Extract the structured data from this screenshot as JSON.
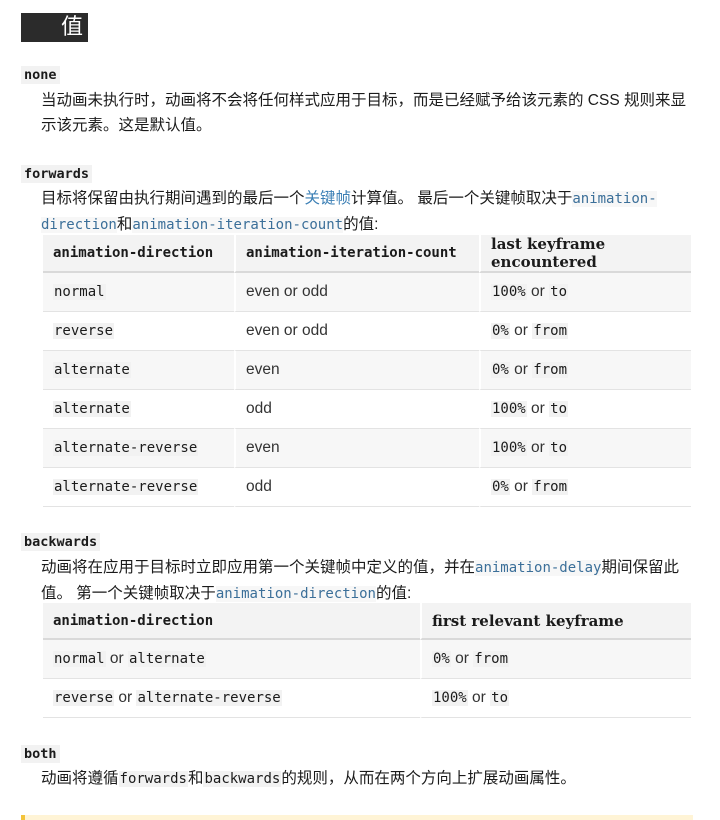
{
  "heading": "值",
  "none": {
    "term": "none",
    "desc": "当动画未执行时，动画将不会将任何样式应用于目标，而是已经赋予给该元素的 CSS 规则来显示该元素。这是默认值。"
  },
  "forwards": {
    "term": "forwards",
    "desc_a": "目标将保留由执行期间遇到的最后一个",
    "desc_link": "关键帧",
    "desc_b": "计算值。 最后一个关键帧取决于",
    "desc_code1": "animation-direction",
    "desc_c": "和",
    "desc_code2": "animation-iteration-count",
    "desc_d": "的值:",
    "table": {
      "headers": [
        "animation-direction",
        "animation-iteration-count",
        "last keyframe encountered"
      ],
      "rows": [
        {
          "dir": "normal",
          "count": "even or odd",
          "kf1": "100%",
          "or": "or",
          "kf2": "to"
        },
        {
          "dir": "reverse",
          "count": "even or odd",
          "kf1": "0%",
          "or": "or",
          "kf2": "from"
        },
        {
          "dir": "alternate",
          "count": "even",
          "kf1": "0%",
          "or": "or",
          "kf2": "from"
        },
        {
          "dir": "alternate",
          "count": "odd",
          "kf1": "100%",
          "or": "or",
          "kf2": "to"
        },
        {
          "dir": "alternate-reverse",
          "count": "even",
          "kf1": "100%",
          "or": "or",
          "kf2": "to"
        },
        {
          "dir": "alternate-reverse",
          "count": "odd",
          "kf1": "0%",
          "or": "or",
          "kf2": "from"
        }
      ]
    }
  },
  "backwards": {
    "term": "backwards",
    "desc_a": "动画将在应用于目标时立即应用第一个关键帧中定义的值，并在",
    "desc_code1": "animation-delay",
    "desc_b": "期间保留此值。 第一个关键帧取决于",
    "desc_code2": "animation-direction",
    "desc_c": "的值:",
    "table": {
      "headers": [
        "animation-direction",
        "first relevant keyframe"
      ],
      "rows": [
        {
          "d1": "normal",
          "or_a": "or",
          "d2": "alternate",
          "kf1": "0%",
          "or_b": "or",
          "kf2": "from"
        },
        {
          "d1": "reverse",
          "or_a": "or",
          "d2": "alternate-reverse",
          "kf1": "100%",
          "or_b": "or",
          "kf2": "to"
        }
      ]
    }
  },
  "both": {
    "term": "both",
    "desc_a": "动画将遵循",
    "desc_code1": "forwards",
    "desc_b": "和",
    "desc_code2": "backwards",
    "desc_c": "的规则，从而在两个方向上扩展动画属性。"
  }
}
